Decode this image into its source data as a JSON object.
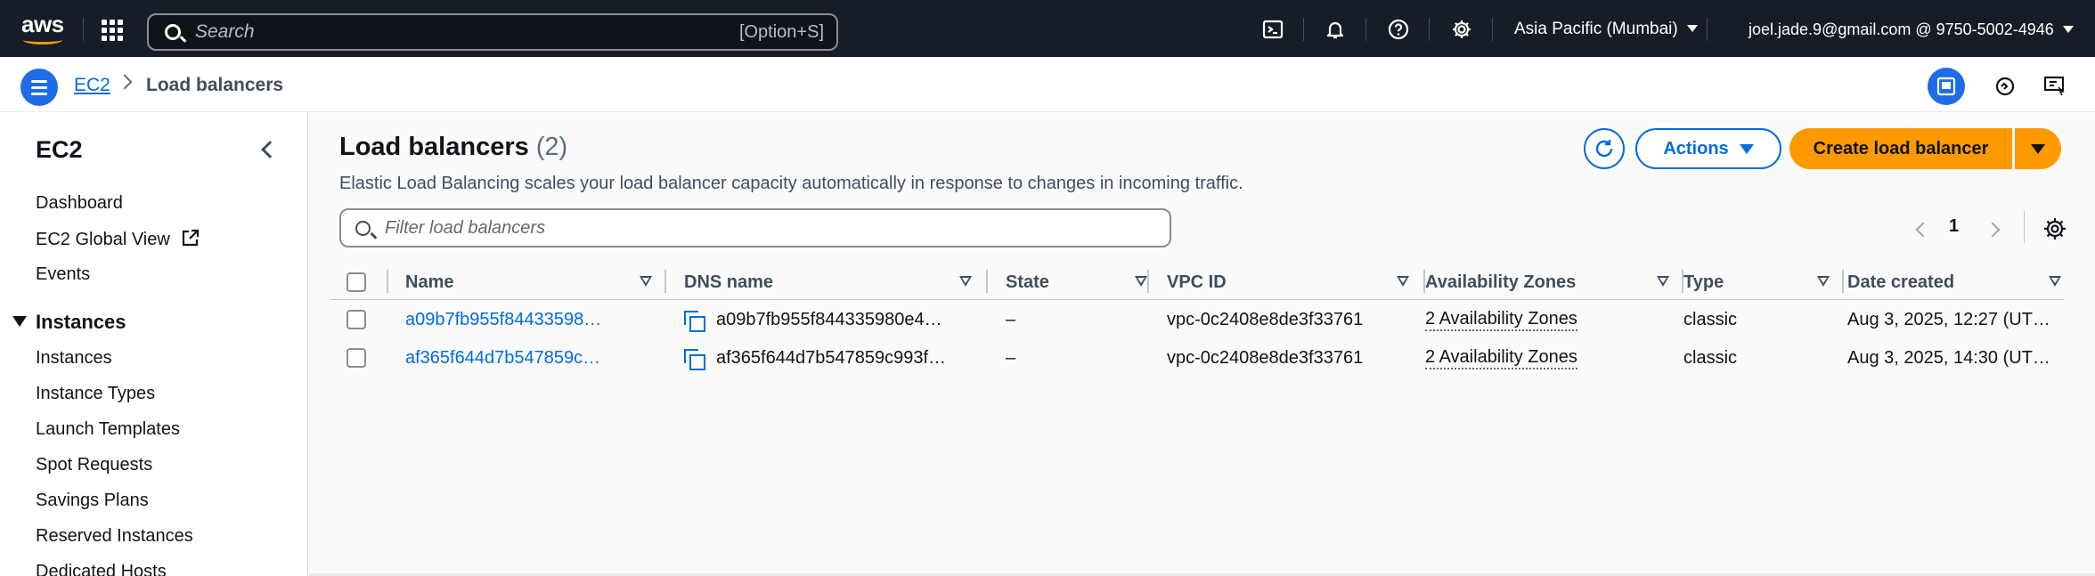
{
  "topnav": {
    "logo_text": "aws",
    "search_placeholder": "Search",
    "search_shortcut": "[Option+S]",
    "region": "Asia Pacific (Mumbai)",
    "account": "joel.jade.9@gmail.com @ 9750-5002-4946"
  },
  "breadcrumb": {
    "parent": "EC2",
    "current": "Load balancers"
  },
  "sidebar": {
    "title": "EC2",
    "top_items": [
      "Dashboard",
      "EC2 Global View",
      "Events"
    ],
    "section": "Instances",
    "section_items": [
      "Instances",
      "Instance Types",
      "Launch Templates",
      "Spot Requests",
      "Savings Plans",
      "Reserved Instances",
      "Dedicated Hosts"
    ]
  },
  "main": {
    "title": "Load balancers",
    "count": "(2)",
    "description": "Elastic Load Balancing scales your load balancer capacity automatically in response to changes in incoming traffic.",
    "actions_label": "Actions",
    "create_label": "Create load balancer",
    "filter_placeholder": "Filter load balancers",
    "page_number": "1"
  },
  "table": {
    "columns": [
      "Name",
      "DNS name",
      "State",
      "VPC ID",
      "Availability Zones",
      "Type",
      "Date created"
    ],
    "rows": [
      {
        "name": "a09b7fb955f84433598…",
        "dns": "a09b7fb955f844335980e4…",
        "state": "–",
        "vpc": "vpc-0c2408e8de3f33761",
        "az": "2 Availability Zones",
        "type": "classic",
        "date": "Aug 3, 2025, 12:27 (UT…"
      },
      {
        "name": "af365f644d7b547859c…",
        "dns": "af365f644d7b547859c993f…",
        "state": "–",
        "vpc": "vpc-0c2408e8de3f33761",
        "az": "2 Availability Zones",
        "type": "classic",
        "date": "Aug 3, 2025, 14:30 (UT…"
      }
    ]
  },
  "colors": {
    "nav_bg": "#161d26",
    "accent_blue": "#006ce0",
    "primary_orange": "#ff9900"
  }
}
